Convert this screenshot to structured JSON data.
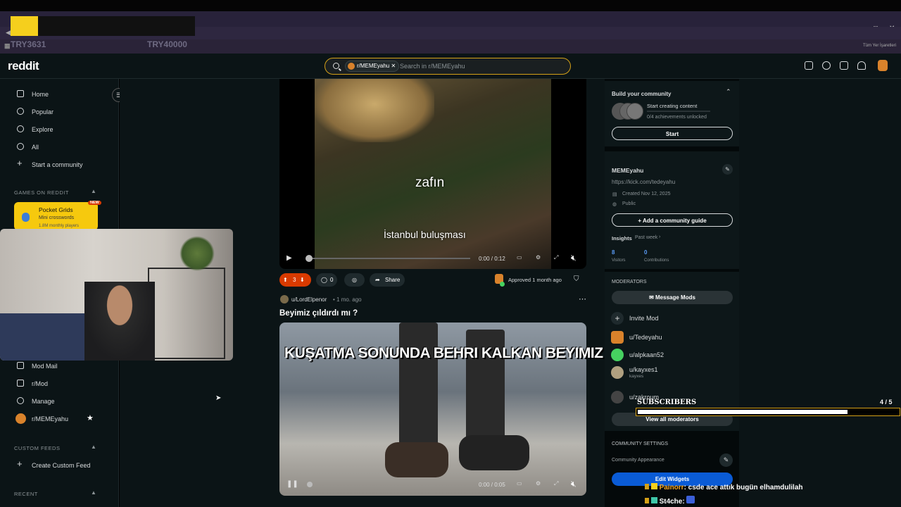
{
  "browser": {
    "bookmark_left": "TRY3631",
    "bookmark_mid": "TRY40000",
    "bookmark_right": "Tüm Yer İşaretleri"
  },
  "header": {
    "logo": "reddit",
    "search_chip": "r/MEMEyahu",
    "search_placeholder": "Search in r/MEMEyahu"
  },
  "sidebar": {
    "items": [
      {
        "label": "Home"
      },
      {
        "label": "Popular"
      },
      {
        "label": "Explore"
      },
      {
        "label": "All"
      },
      {
        "label": "Start a community"
      }
    ],
    "games_title": "GAMES ON REDDIT",
    "game": {
      "name": "Pocket Grids",
      "sub": "Mini crosswords",
      "players": "1.8M monthly players",
      "badge": "NEW"
    },
    "mod_items": [
      {
        "label": "Mod Mail"
      },
      {
        "label": "r/Mod"
      },
      {
        "label": "Manage"
      },
      {
        "label": "r/MEMEyahu"
      }
    ],
    "custom_title": "CUSTOM FEEDS",
    "custom_create": "Create Custom Feed",
    "recent_title": "RECENT"
  },
  "post1": {
    "caption_top": "zafın",
    "caption_bottom": "İstanbul buluşması",
    "time": "0:00 / 0:12",
    "votes": "3",
    "comments": "0",
    "share": "Share",
    "approved": "Approved 1 month ago"
  },
  "post2": {
    "author": "u/LordElpenor",
    "age": "• 1 mo. ago",
    "title": "Beyimiz çıldırdı mı ?",
    "banner": "KUŞATMA SONUNDA BEHRI KALKAN BEYIMIZ",
    "time": "0:00 / 0:05"
  },
  "right": {
    "build_title": "Build your community",
    "build_task": "Start creating content",
    "build_progress": "0/4 achievements unlocked",
    "start_btn": "Start",
    "community_name": "MEMEyahu",
    "community_link": "https://kick.com/tedeyahu",
    "created": "Created Nov 12, 2025",
    "visibility": "Public",
    "guide_btn": "Add a community guide",
    "insights": "Insights",
    "insights_period": "Past week",
    "visitors_num": "8",
    "visitors_label": "Visitors",
    "contrib_num": "0",
    "contrib_label": "Contributions",
    "moderators_title": "MODERATORS",
    "message_mods": "Message Mods",
    "invite_mod": "Invite Mod",
    "mods": [
      {
        "name": "u/Tedeyahu",
        "color": "#d9822b",
        "sub": ""
      },
      {
        "name": "u/alpkaan52",
        "color": "#46d160",
        "sub": ""
      },
      {
        "name": "u/kayxes1",
        "color": "#b0a080",
        "sub": "kayxes"
      },
      {
        "name": "u/zakroum",
        "color": "#444444",
        "sub": ""
      }
    ],
    "view_all": "View all moderators",
    "settings_title": "COMMUNITY SETTINGS",
    "appearance": "Community Appearance",
    "edit_widgets": "Edit Widgets"
  },
  "overlay": {
    "subscribers_label": "SUBSCRIBERS",
    "subscribers_count": "4 / 5",
    "subscribers_progress": 0.8,
    "chat": [
      {
        "user": "Painorr",
        "msg": ": csde ace attık bugün elhamdulilah",
        "color": "#f5a623"
      },
      {
        "user": "St4che",
        "msg": ":",
        "color": "#ffffff"
      }
    ]
  },
  "colors": {
    "accent": "#d93a00",
    "search_border": "#d4a017",
    "button_blue": "#0a5bd6",
    "pocket": "#f6c90e"
  }
}
